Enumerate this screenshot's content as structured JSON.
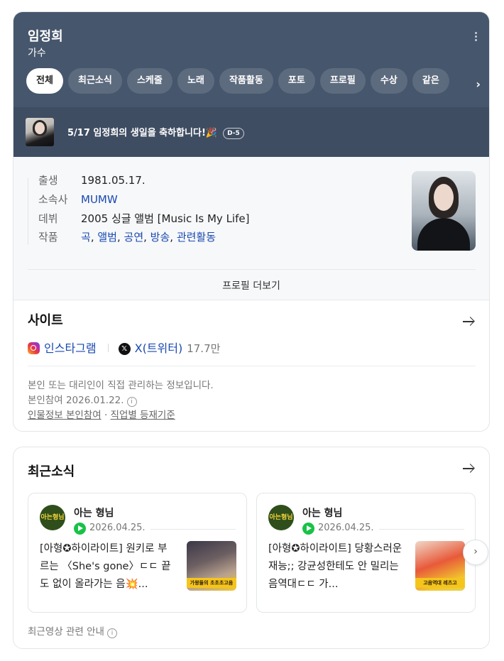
{
  "profile": {
    "name": "임정희",
    "occupation": "가수",
    "tabs": [
      {
        "label": "전체",
        "active": true
      },
      {
        "label": "최근소식"
      },
      {
        "label": "스케줄"
      },
      {
        "label": "노래"
      },
      {
        "label": "작품활동"
      },
      {
        "label": "포토"
      },
      {
        "label": "프로필"
      },
      {
        "label": "수상"
      },
      {
        "label": "같은"
      }
    ],
    "birthday_banner": {
      "text": "5/17 임정희의 생일을 축하합니다!🎉",
      "dday": "D-5"
    },
    "info": {
      "birth_label": "출생",
      "birth_value": "1981.05.17.",
      "agency_label": "소속사",
      "agency_value": "MUMW",
      "debut_label": "데뷔",
      "debut_value": "2005 싱글 앨범 [Music Is My Life]",
      "works_label": "작품",
      "works_links": [
        "곡",
        "앨범",
        "공연",
        "방송",
        "관련활동"
      ]
    },
    "profile_more": "프로필 더보기"
  },
  "site": {
    "title": "사이트",
    "instagram_label": "인스타그램",
    "twitter_label": "X(트위터)",
    "twitter_followers": "17.7만",
    "note_managed": "본인 또는 대리인이 직접 관리하는 정보입니다.",
    "note_participation": "본인참여 2026.01.22.",
    "link_participate": "인물정보 본인참여",
    "link_criteria": "직업별 등재기준"
  },
  "news": {
    "title": "최근소식",
    "items": [
      {
        "channel": "아는 형님",
        "avatar_text": "아는형님",
        "date": "2026.04.25.",
        "text": "[아형✪하이라이트] 원키로 부르는 〈She's gone〉ㄷㄷ 끝도 없이 올라가는 음💥...",
        "thumb_caption": "가왕들의 초초초고음"
      },
      {
        "channel": "아는 형님",
        "avatar_text": "아는형님",
        "date": "2026.04.25.",
        "text": "[아형✪하이라이트] 당황스러운 재능;; 강균성한테도 안 밀리는 음역대ㄷㄷ 가...",
        "thumb_caption": "고음역대 레츠고"
      }
    ],
    "footer_note": "최근영상 관련 안내"
  },
  "colors": {
    "header_bg": "#46566c",
    "banner_bg": "#3f4d62",
    "link_blue": "#1a49b0",
    "play_green": "#19c247"
  },
  "icons": [
    "more-vertical-icon",
    "chevron-right-icon",
    "arrow-right-icon",
    "instagram-icon",
    "x-twitter-icon",
    "info-icon",
    "play-icon"
  ]
}
